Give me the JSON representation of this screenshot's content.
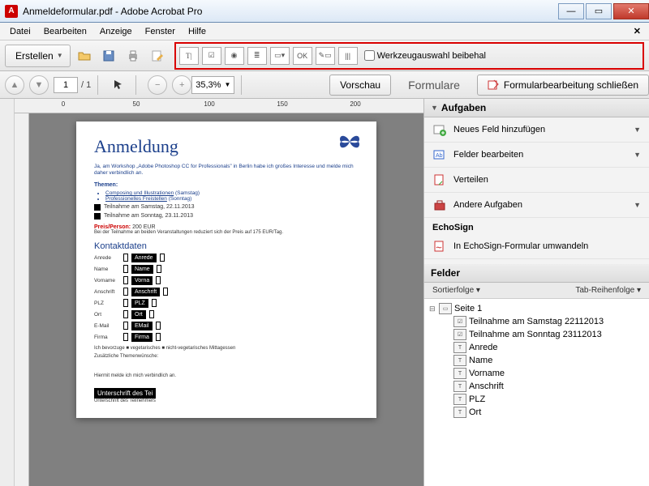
{
  "window": {
    "title": "Anmeldeformular.pdf - Adobe Acrobat Pro"
  },
  "menu": {
    "items": [
      "Datei",
      "Bearbeiten",
      "Anzeige",
      "Fenster",
      "Hilfe"
    ]
  },
  "toolbar": {
    "create": "Erstellen",
    "keep_tool_label": "Werkzeugauswahl beibehal"
  },
  "nav": {
    "page_current": "1",
    "page_total": "/ 1",
    "zoom": "35,3%",
    "preview": "Vorschau",
    "forms": "Formulare",
    "close_edit": "Formularbearbeitung schließen"
  },
  "ruler": {
    "marks": [
      "0",
      "50",
      "100",
      "150",
      "200"
    ]
  },
  "document": {
    "heading": "Anmeldung",
    "intro": "Ja, am Workshop „Adobe Photoshop CC for Professionals” in Berlin habe ich großes Interesse und melde mich daher verbindlich an.",
    "themen_label": "Themen:",
    "bullet1": "Composing und Illustrationen",
    "bullet1_note": "(Samstag)",
    "bullet2": "Professionelles Freistellen",
    "bullet2_note": "(Sonntag)",
    "check1": "Teilnahme am Samstag, 22.11.2013",
    "check2": "Teilnahme am Sonntag, 23.11.2013",
    "preis_label": "Preis/Person:",
    "preis_value": "200 EUR",
    "preis_note": "Bei der Teilnahme an beiden Veranstaltungen reduziert sich der Preis auf 175 EUR/Tag.",
    "kontakt_heading": "Kontaktdaten",
    "field_anrede_lbl": "Anrede",
    "field_anrede_val": "Anrede",
    "field_name_lbl": "Name",
    "field_name_val": "Name",
    "field_vorname_lbl": "Vorname",
    "field_vorname_val": "Vorna",
    "field_anschrift_lbl": "Anschrift",
    "field_anschrift_val": "Anschrift",
    "field_plz_lbl": "PLZ",
    "field_plz_val": "PLZ",
    "field_ort_lbl": "Ort",
    "field_ort_val": "Ort",
    "field_email_lbl": "E-Mail",
    "field_email_val": "EMail",
    "field_firma_lbl": "Firma",
    "field_firma_val": "Firma",
    "pref_line": "Ich bevorzuge ■ vegetarisches ■ nicht-vegetarisches Mittagessen",
    "extra_line": "Zusätzliche Themenwünsche:",
    "bindung": "Hiermit melde ich mich verbindlich an.",
    "sig_field": "Unterschrift des Tei",
    "sig_caption": "Unterschrift des Teilnehmers"
  },
  "panel": {
    "tasks_header": "Aufgaben",
    "task_new": "Neues Feld hinzufügen",
    "task_edit": "Felder bearbeiten",
    "task_dist": "Verteilen",
    "task_other": "Andere Aufgaben",
    "echosign_header": "EchoSign",
    "echosign_convert": "In EchoSign-Formular umwandeln",
    "fields_header": "Felder",
    "sort_label": "Sortierfolge ▾",
    "tab_order": "Tab-Reihenfolge ▾",
    "tree_root": "Seite 1",
    "tree_items": [
      {
        "icon": "☑",
        "label": "Teilnahme am Samstag 22112013"
      },
      {
        "icon": "☑",
        "label": "Teilnahme am Sonntag 23112013"
      },
      {
        "icon": "T",
        "label": "Anrede"
      },
      {
        "icon": "T",
        "label": "Name"
      },
      {
        "icon": "T",
        "label": "Vorname"
      },
      {
        "icon": "T",
        "label": "Anschrift"
      },
      {
        "icon": "T",
        "label": "PLZ"
      },
      {
        "icon": "T",
        "label": "Ort"
      }
    ]
  }
}
